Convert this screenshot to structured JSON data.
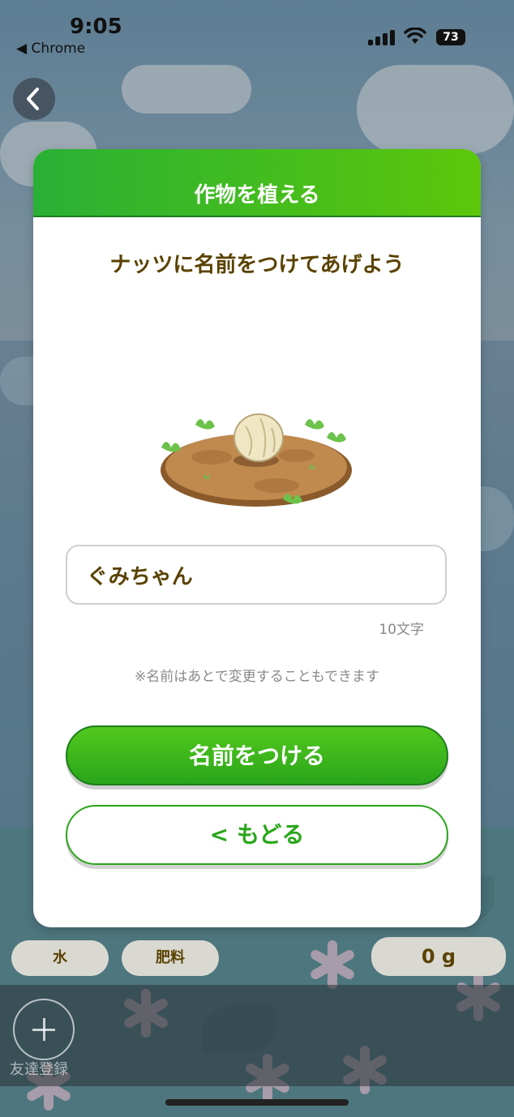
{
  "status_bar": {
    "time": "9:05",
    "back_app": "◀ Chrome",
    "battery": "73"
  },
  "modal": {
    "title": "作物を植える",
    "subtitle": "ナッツに名前をつけてあげよう",
    "name_input": {
      "value": "ぐみちゃん",
      "placeholder": ""
    },
    "char_limit": "10文字",
    "note": "※名前はあとで変更することもできます",
    "primary_button": "名前をつける",
    "secondary_button": "< もどる"
  },
  "bottom_bar": {
    "water_label": "水",
    "fertilizer_label": "肥料",
    "weight_label": "0 g",
    "add_friend_label": "友達登録"
  },
  "colors": {
    "accent_green": "#2aa51a",
    "text_brown": "#5a4200"
  }
}
